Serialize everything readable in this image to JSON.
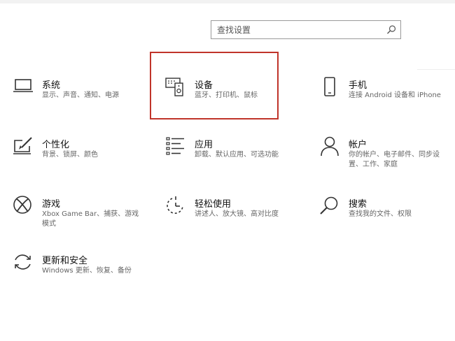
{
  "search": {
    "placeholder": "查找设置"
  },
  "tiles": [
    {
      "id": "system",
      "title": "系统",
      "desc": [
        "显示、声音、通知、电源"
      ],
      "icon": "laptop-icon"
    },
    {
      "id": "devices",
      "title": "设备",
      "desc": [
        "蓝牙、打印机、鼠标"
      ],
      "icon": "devices-icon",
      "highlighted": true
    },
    {
      "id": "phone",
      "title": "手机",
      "desc": [
        "连接 Android 设备和 iPhone"
      ],
      "icon": "phone-icon"
    },
    {
      "id": "personalization",
      "title": "个性化",
      "desc": [
        "背景、锁屏、颜色"
      ],
      "icon": "paint-icon"
    },
    {
      "id": "apps",
      "title": "应用",
      "desc": [
        "卸载、默认应用、可选功能"
      ],
      "icon": "apps-list-icon"
    },
    {
      "id": "accounts",
      "title": "帐户",
      "desc": [
        "你的帐户、电子邮件、同步设",
        "置、工作、家庭"
      ],
      "icon": "person-icon"
    },
    {
      "id": "gaming",
      "title": "游戏",
      "desc": [
        "Xbox Game Bar、捕获、游戏",
        "模式"
      ],
      "icon": "xbox-icon"
    },
    {
      "id": "ease-of-access",
      "title": "轻松使用",
      "desc": [
        "讲述人、放大镜、高对比度"
      ],
      "icon": "ease-of-access-icon"
    },
    {
      "id": "search",
      "title": "搜索",
      "desc": [
        "查找我的文件、权限"
      ],
      "icon": "search-icon"
    },
    {
      "id": "update-security",
      "title": "更新和安全",
      "desc": [
        "Windows 更新、恢复、备份"
      ],
      "icon": "sync-icon"
    }
  ],
  "colors": {
    "highlight": "#c0342a",
    "icon": "#333333",
    "title": "#111111",
    "desc": "#666666"
  }
}
